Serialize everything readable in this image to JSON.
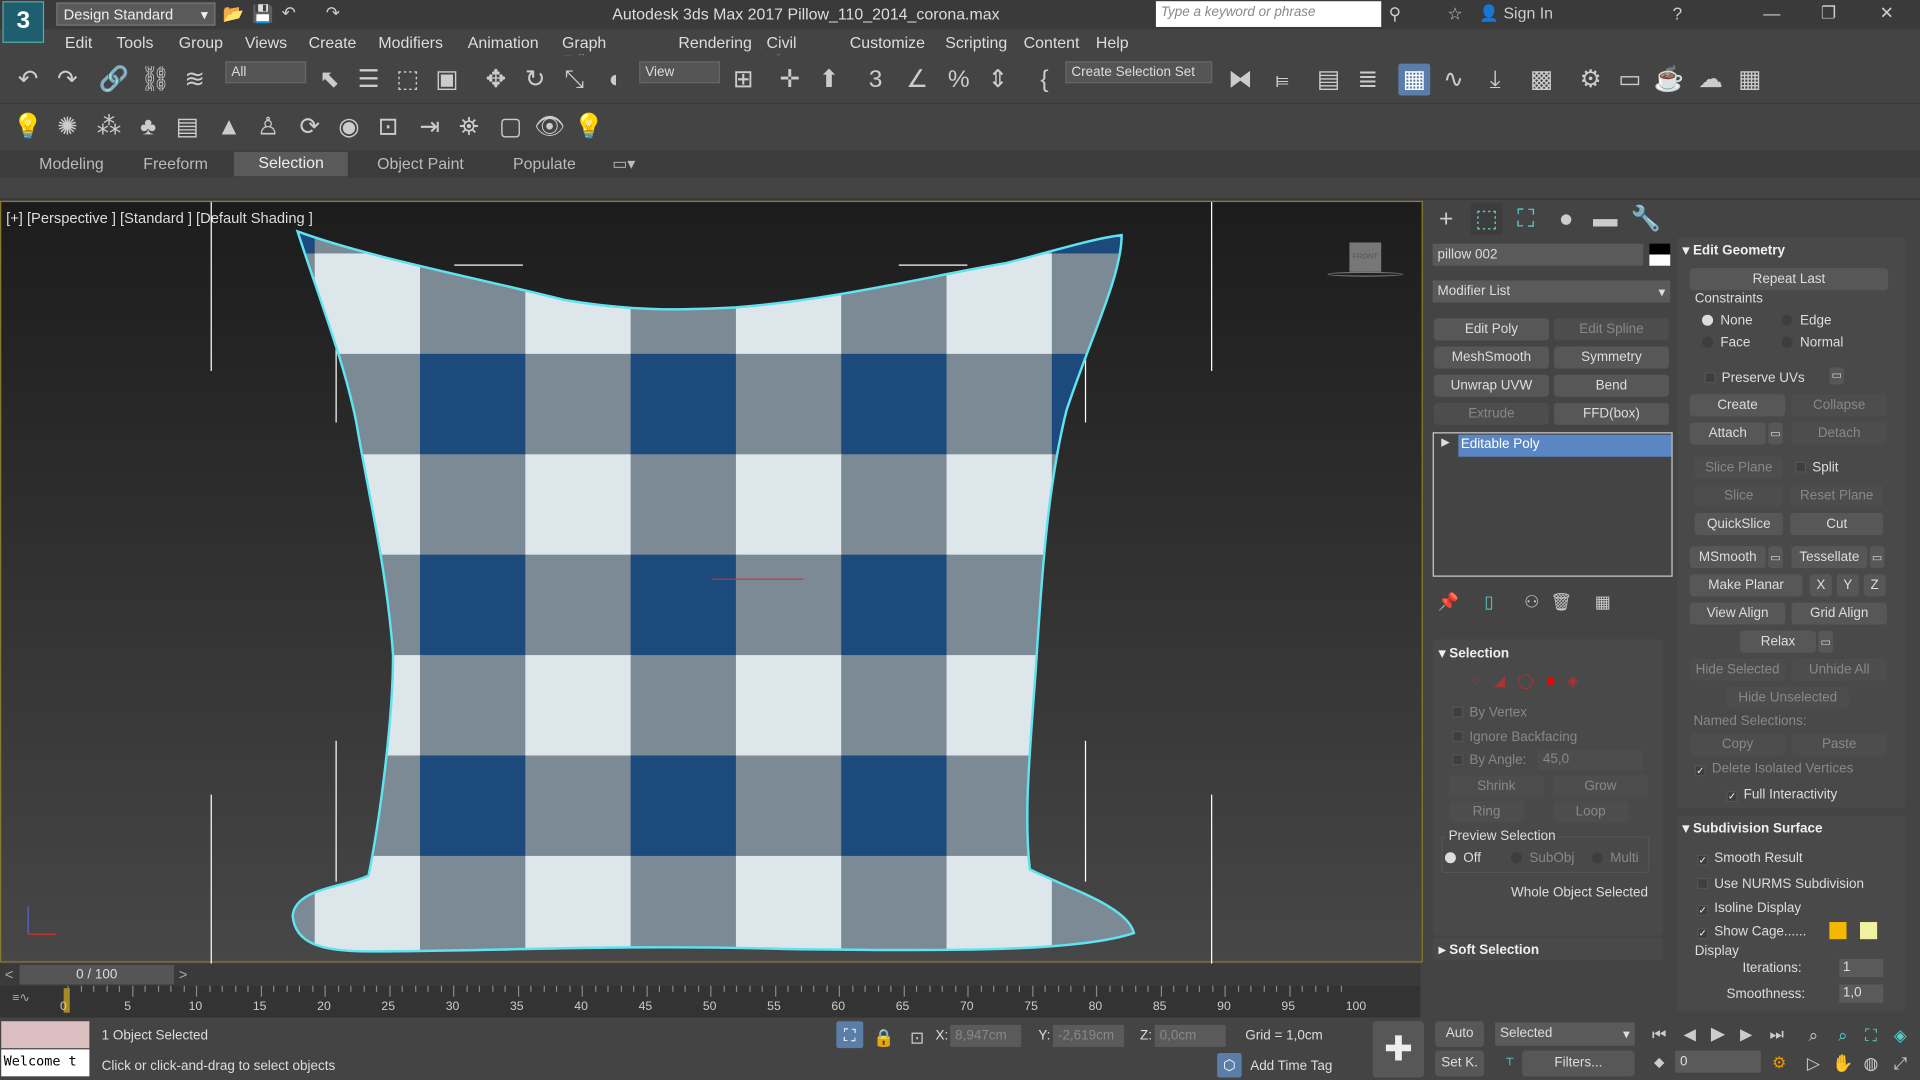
{
  "titlebar": {
    "app_icon": "3ds MAX",
    "app_icon_sub": "MAX",
    "workspace": "Design Standard",
    "title": "Autodesk 3ds Max 2017    Pillow_110_2014_corona.max",
    "search_placeholder": "Type a keyword or phrase",
    "sign_in": "Sign In"
  },
  "menu": [
    "Edit",
    "Tools",
    "Group",
    "Views",
    "Create",
    "Modifiers",
    "Animation",
    "Graph Editors",
    "Rendering",
    "Civil View",
    "Customize",
    "Scripting",
    "Content",
    "Help"
  ],
  "toolbar": {
    "filter": "All",
    "ref_coord": "View",
    "selection_set": "Create Selection Set"
  },
  "ribbon": {
    "tabs": [
      "Modeling",
      "Freeform",
      "Selection",
      "Object Paint",
      "Populate"
    ],
    "active": "Selection"
  },
  "viewport": {
    "label": "[+] [Perspective ] [Standard ] [Default Shading ]",
    "viewcube": "FRONT",
    "axis_z": "z",
    "checker_colors": {
      "navy": "#1d4a7c",
      "gray": "#7b8a94",
      "white": "#dde7eb"
    },
    "selection_color": "#5fe3f0"
  },
  "command_panel": {
    "object_name": "pillow 002",
    "modifier_list": "Modifier List",
    "modifier_buttons": [
      {
        "label": "Edit Poly",
        "enabled": true
      },
      {
        "label": "Edit Spline",
        "enabled": false
      },
      {
        "label": "MeshSmooth",
        "enabled": true
      },
      {
        "label": "Symmetry",
        "enabled": true
      },
      {
        "label": "Unwrap UVW",
        "enabled": true
      },
      {
        "label": "Bend",
        "enabled": true
      },
      {
        "label": "Extrude",
        "enabled": false
      },
      {
        "label": "FFD(box)",
        "enabled": true
      }
    ],
    "stack_item": "Editable Poly",
    "selection": {
      "title": "Selection",
      "by_vertex": "By Vertex",
      "ignore_backfacing": "Ignore Backfacing",
      "by_angle": "By Angle:",
      "angle_value": "45,0",
      "shrink": "Shrink",
      "grow": "Grow",
      "ring": "Ring",
      "loop": "Loop",
      "preview": "Preview Selection",
      "off": "Off",
      "subobj": "SubObj",
      "multi": "Multi",
      "status": "Whole Object Selected"
    },
    "soft_selection": "Soft Selection"
  },
  "edit_geometry": {
    "title": "Edit Geometry",
    "repeat_last": "Repeat Last",
    "constraints": "Constraints",
    "none": "None",
    "edge": "Edge",
    "face": "Face",
    "normal": "Normal",
    "preserve_uvs": "Preserve UVs",
    "create": "Create",
    "collapse": "Collapse",
    "attach": "Attach",
    "detach": "Detach",
    "slice_plane": "Slice Plane",
    "split": "Split",
    "slice": "Slice",
    "reset_plane": "Reset Plane",
    "quickslice": "QuickSlice",
    "cut": "Cut",
    "msmooth": "MSmooth",
    "tessellate": "Tessellate",
    "make_planar": "Make Planar",
    "x": "X",
    "y": "Y",
    "z": "Z",
    "view_align": "View Align",
    "grid_align": "Grid Align",
    "relax": "Relax",
    "hide_selected": "Hide Selected",
    "unhide_all": "Unhide All",
    "hide_unselected": "Hide Unselected",
    "named_selections": "Named Selections:",
    "copy": "Copy",
    "paste": "Paste",
    "delete_isolated": "Delete Isolated Vertices",
    "full_interactivity": "Full Interactivity"
  },
  "subdivision": {
    "title": "Subdivision Surface",
    "smooth_result": "Smooth Result",
    "use_nurms": "Use NURMS Subdivision",
    "isoline": "Isoline Display",
    "show_cage": "Show Cage......",
    "display": "Display",
    "iterations_label": "Iterations:",
    "iterations": "1",
    "smoothness_label": "Smoothness:",
    "smoothness": "1,0",
    "cage_colors": [
      "#f5b800",
      "#f0f0a0"
    ]
  },
  "timeline": {
    "frame": "0 / 100",
    "ticks": [
      "0",
      "5",
      "10",
      "15",
      "20",
      "25",
      "30",
      "35",
      "40",
      "45",
      "50",
      "55",
      "60",
      "65",
      "70",
      "75",
      "80",
      "85",
      "90",
      "95",
      "100"
    ]
  },
  "status": {
    "listener": "Welcome t",
    "selected": "1 Object Selected",
    "prompt": "Click or click-and-drag to select objects",
    "x_label": "X:",
    "x": "8,947cm",
    "y_label": "Y:",
    "y": "-2,619cm",
    "z_label": "Z:",
    "z": "0,0cm",
    "grid": "Grid = 1,0cm",
    "add_time_tag": "Add Time Tag",
    "auto": "Auto",
    "set_key": "Set K.",
    "key_mode": "Selected",
    "filters": "Filters...",
    "current_frame": "0"
  }
}
